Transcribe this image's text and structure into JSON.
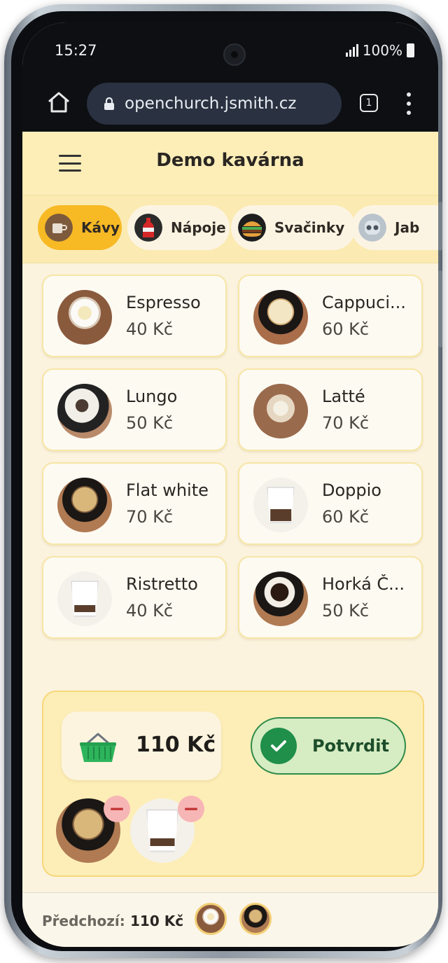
{
  "status": {
    "time": "15:27",
    "battery": "100%"
  },
  "browser": {
    "url": "openchurch.jsmith.cz",
    "tab_count": "1"
  },
  "header": {
    "title": "Demo kavárna"
  },
  "categories": [
    {
      "label": "Kávy",
      "icon": "coffee-cup-icon",
      "active": true
    },
    {
      "label": "Nápoje",
      "icon": "soda-bottle-icon",
      "active": false
    },
    {
      "label": "Svačinky",
      "icon": "burger-icon",
      "active": false
    },
    {
      "label": "Jab",
      "icon": "robot-icon",
      "active": false
    }
  ],
  "products": [
    {
      "name": "Espresso",
      "price": "40 Kč"
    },
    {
      "name": "Cappuci...",
      "price": "60 Kč"
    },
    {
      "name": "Lungo",
      "price": "50 Kč"
    },
    {
      "name": "Latté",
      "price": "70 Kč"
    },
    {
      "name": "Flat white",
      "price": "70 Kč"
    },
    {
      "name": "Doppio",
      "price": "60 Kč"
    },
    {
      "name": "Ristretto",
      "price": "40 Kč"
    },
    {
      "name": "Horká Č...",
      "price": "50 Kč"
    }
  ],
  "cart": {
    "total": "110 Kč",
    "confirm_label": "Potvrdit",
    "items": [
      "Flat white",
      "Ristretto"
    ]
  },
  "previous": {
    "label": "Předchozí:",
    "amount": "110 Kč"
  },
  "colors": {
    "accent": "#f7b924",
    "confirm_green": "#1f8f4a",
    "header_bg": "#fdeeb8"
  }
}
